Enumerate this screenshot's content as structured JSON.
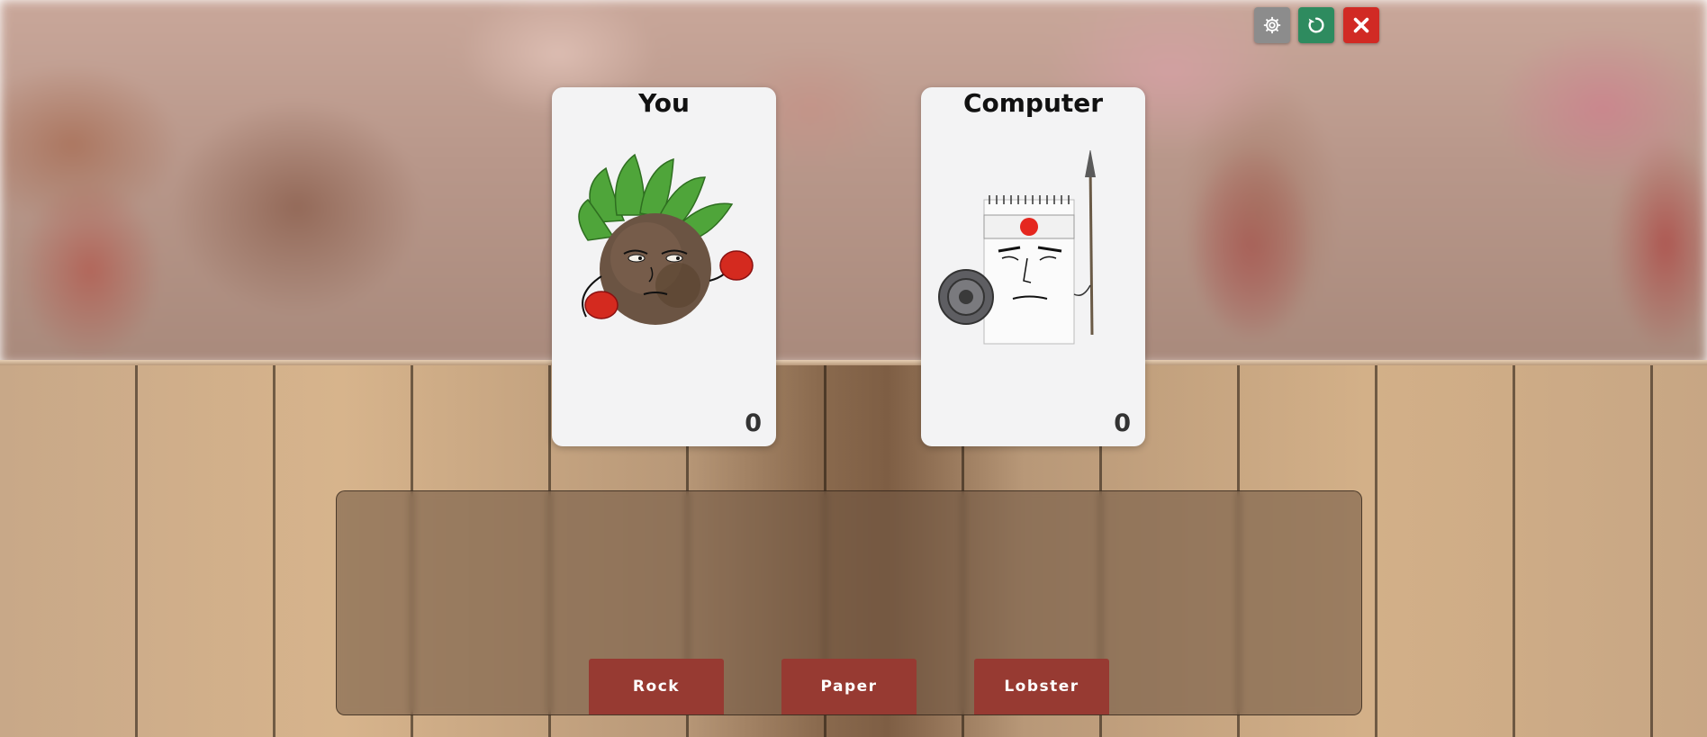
{
  "controls": {
    "settings_icon": "gear-icon",
    "restart_icon": "restart-icon",
    "close_icon": "close-icon",
    "colors": {
      "settings": "#8c8c8c",
      "restart": "#2e8b5f",
      "close": "#d12a24"
    }
  },
  "player": {
    "title": "You",
    "score": "0",
    "art": "rock-character"
  },
  "computer": {
    "title": "Computer",
    "score": "0",
    "art": "paper-warrior-character"
  },
  "choices": [
    {
      "label": "Rock"
    },
    {
      "label": "Paper"
    },
    {
      "label": "Lobster"
    }
  ],
  "colors": {
    "choice_button": "#973a32",
    "card": "#f3f3f4"
  }
}
